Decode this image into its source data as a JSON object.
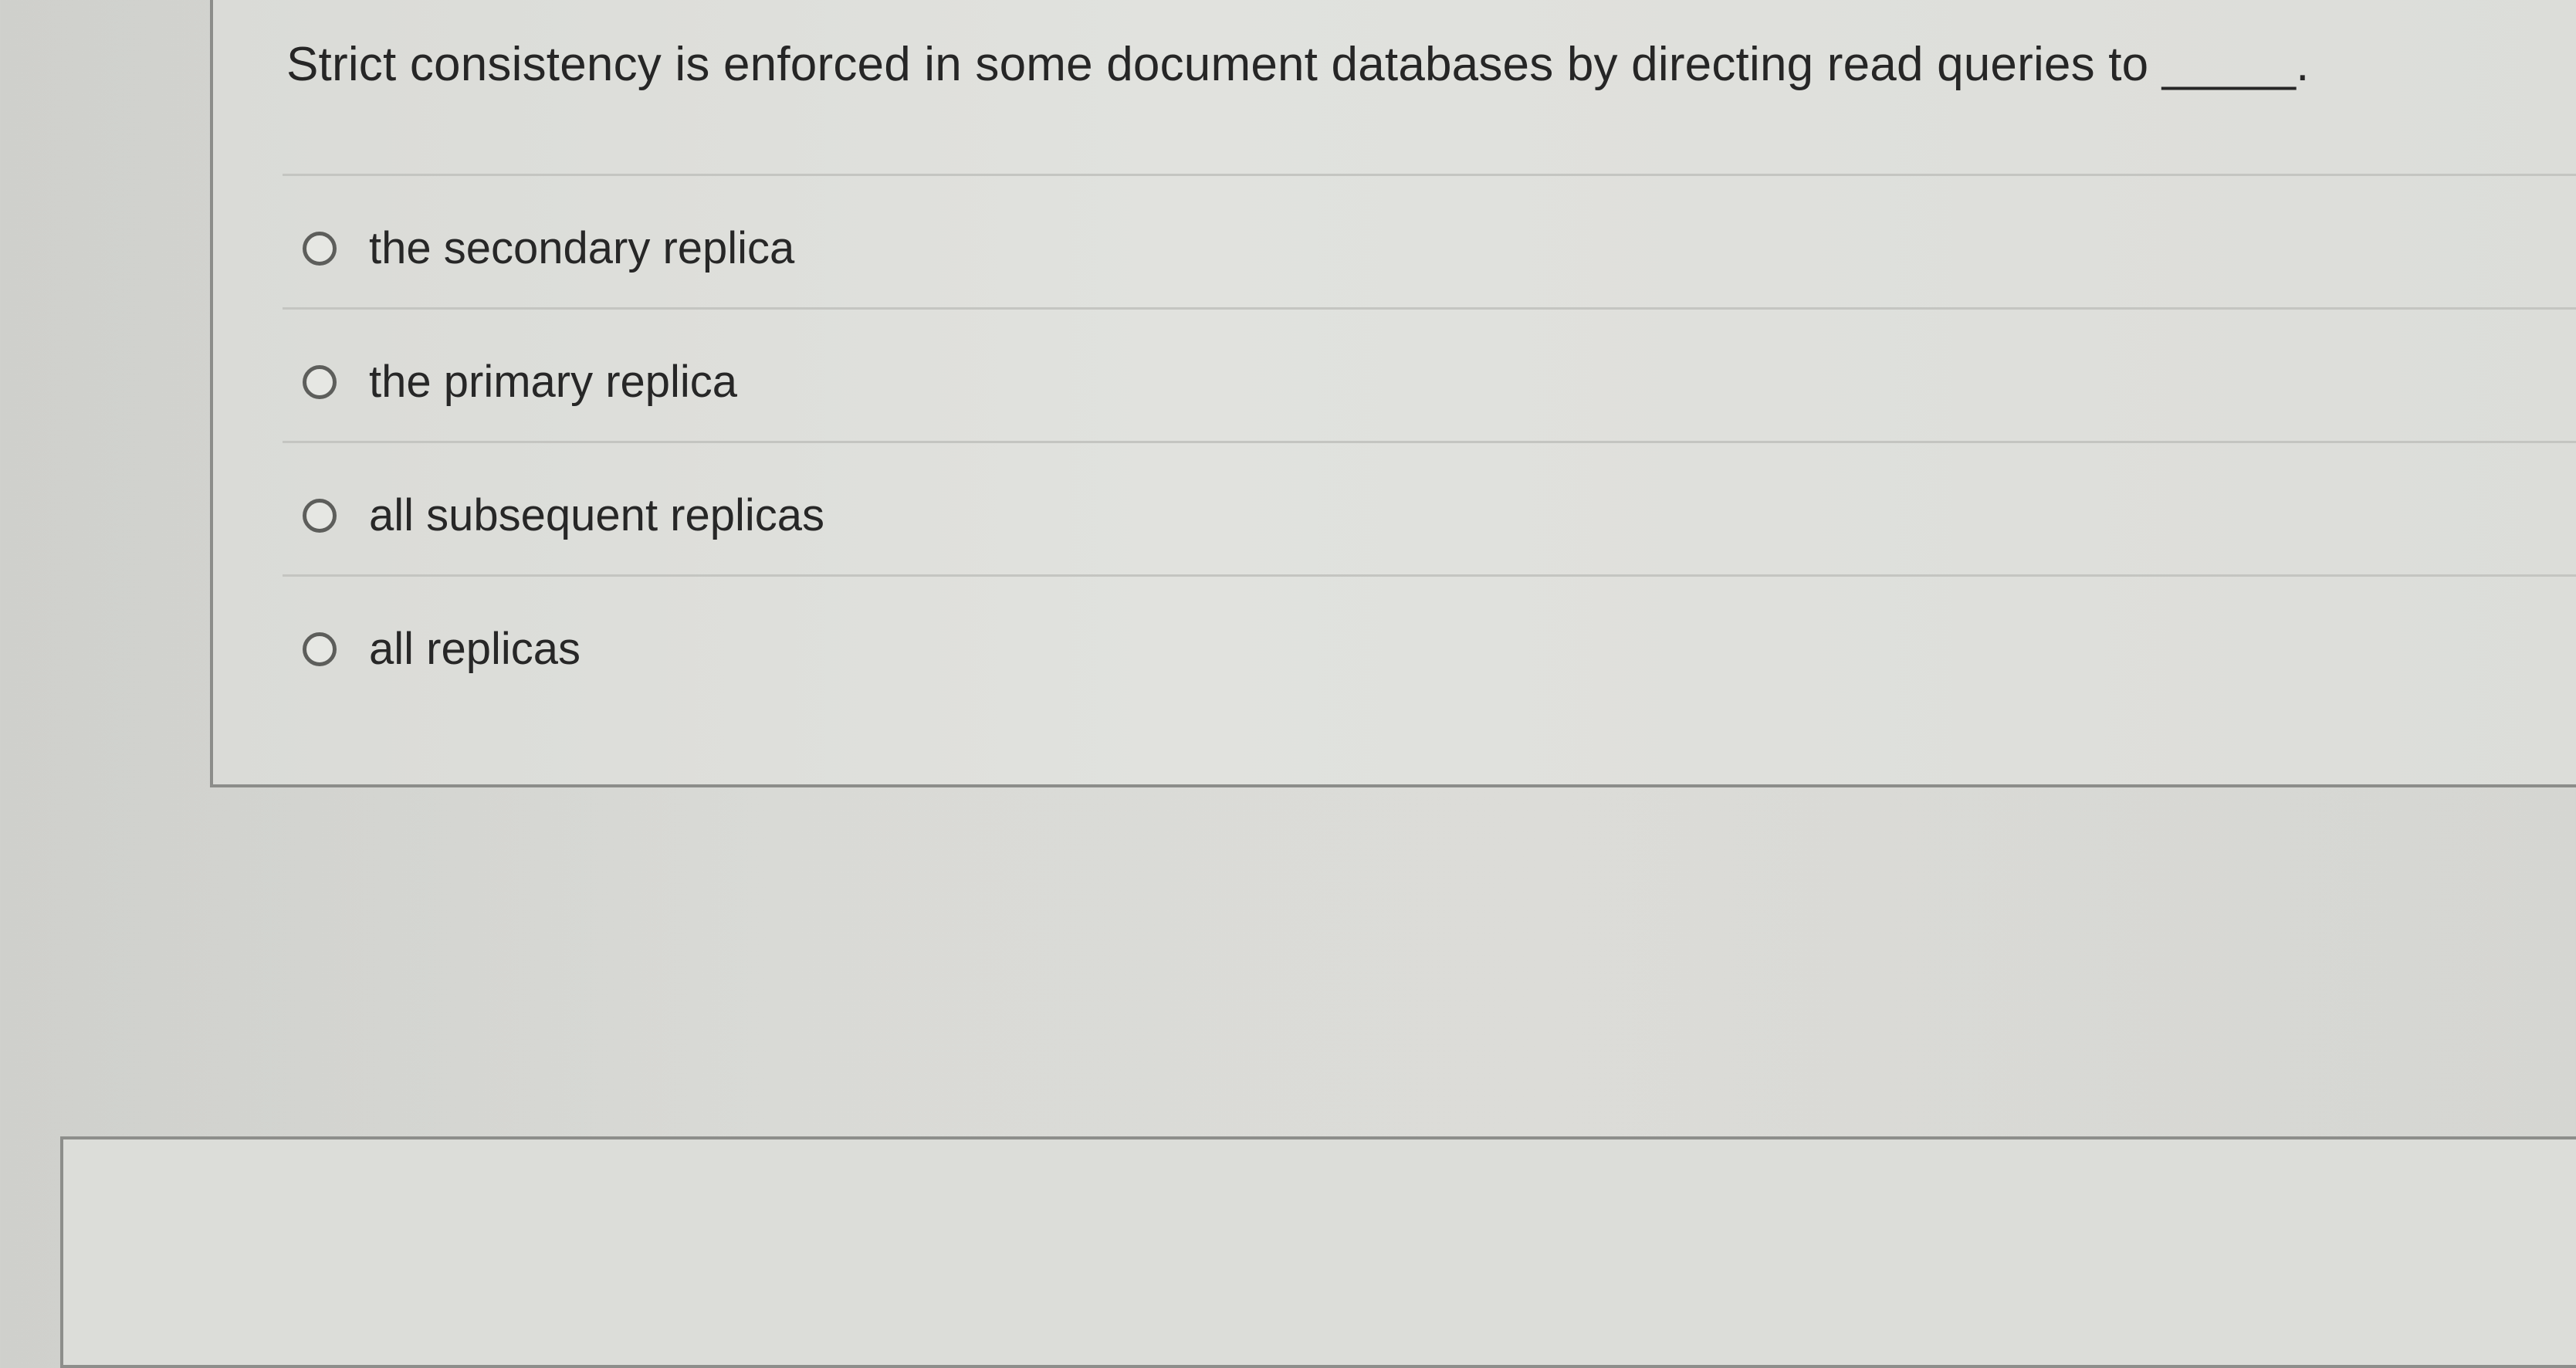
{
  "question": {
    "text": "Strict consistency is enforced in some document databases by directing read queries to _____."
  },
  "answers": [
    {
      "label": "the secondary replica",
      "selected": false
    },
    {
      "label": "the primary replica",
      "selected": false
    },
    {
      "label": "all subsequent replicas",
      "selected": false
    },
    {
      "label": "all replicas",
      "selected": false
    }
  ]
}
